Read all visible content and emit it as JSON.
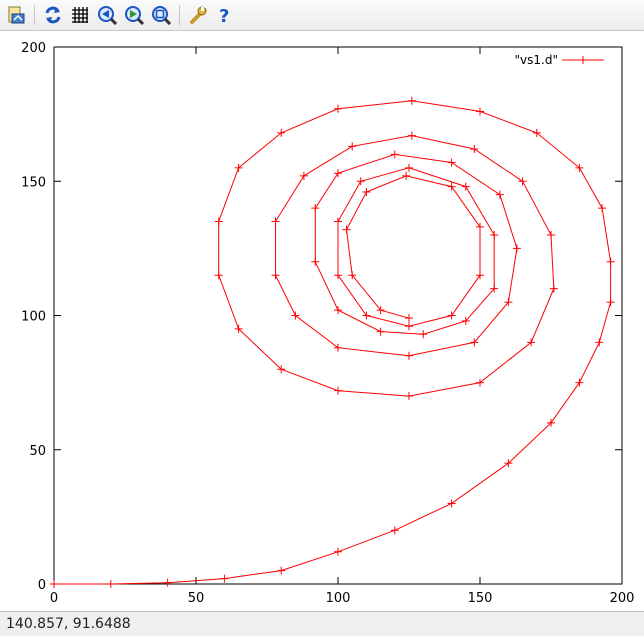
{
  "toolbar": {
    "buttons": [
      {
        "name": "export-icon"
      },
      {
        "name": "replot-icon"
      },
      {
        "name": "grid-icon"
      },
      {
        "name": "zoom-previous-icon"
      },
      {
        "name": "zoom-next-icon"
      },
      {
        "name": "autoscale-icon"
      },
      {
        "name": "options-wrench-icon"
      },
      {
        "name": "help-icon"
      }
    ]
  },
  "status": {
    "coordinates": "140.857, 91.6488"
  },
  "colors": {
    "series": "#ff0000",
    "axis": "#000000",
    "toolbar_blue": "#1a55c4"
  },
  "chart_data": {
    "type": "line",
    "title": "",
    "xlabel": "",
    "ylabel": "",
    "xlim": [
      0,
      200
    ],
    "ylim": [
      0,
      200
    ],
    "xticks": [
      "0",
      "50",
      "100",
      "150",
      "200"
    ],
    "yticks": [
      "0",
      "50",
      "100",
      "150",
      "200"
    ],
    "grid": false,
    "legend": {
      "position": "top-right"
    },
    "marker": "+",
    "series": [
      {
        "name": "\"vs1.d\"",
        "description_points": [
          [
            0,
            0
          ],
          [
            20,
            0
          ],
          [
            40,
            0.5
          ],
          [
            60,
            2
          ],
          [
            80,
            5
          ],
          [
            100,
            12
          ],
          [
            120,
            20
          ],
          [
            140,
            30
          ],
          [
            160,
            45
          ],
          [
            175,
            60
          ],
          [
            185,
            75
          ],
          [
            192,
            90
          ],
          [
            196,
            105
          ],
          [
            196,
            120
          ],
          [
            193,
            140
          ],
          [
            185,
            155
          ],
          [
            170,
            168
          ],
          [
            150,
            176
          ],
          [
            126,
            180
          ],
          [
            100,
            177
          ],
          [
            80,
            168
          ],
          [
            65,
            155
          ],
          [
            58,
            135
          ],
          [
            58,
            115
          ],
          [
            65,
            95
          ],
          [
            80,
            80
          ],
          [
            100,
            72
          ],
          [
            125,
            70
          ],
          [
            150,
            75
          ],
          [
            168,
            90
          ],
          [
            176,
            110
          ],
          [
            175,
            130
          ],
          [
            165,
            150
          ],
          [
            148,
            162
          ],
          [
            126,
            167
          ],
          [
            105,
            163
          ],
          [
            88,
            152
          ],
          [
            78,
            135
          ],
          [
            78,
            115
          ],
          [
            85,
            100
          ],
          [
            100,
            88
          ],
          [
            125,
            85
          ],
          [
            148,
            90
          ],
          [
            160,
            105
          ],
          [
            163,
            125
          ],
          [
            157,
            145
          ],
          [
            140,
            157
          ],
          [
            120,
            160
          ],
          [
            100,
            153
          ],
          [
            92,
            140
          ],
          [
            92,
            120
          ],
          [
            100,
            102
          ],
          [
            115,
            94
          ],
          [
            130,
            93
          ],
          [
            145,
            98
          ],
          [
            155,
            110
          ],
          [
            155,
            130
          ],
          [
            145,
            148
          ],
          [
            125,
            155
          ],
          [
            108,
            150
          ],
          [
            100,
            135
          ],
          [
            100,
            115
          ],
          [
            110,
            100
          ],
          [
            125,
            96
          ],
          [
            140,
            100
          ],
          [
            150,
            115
          ],
          [
            150,
            133
          ],
          [
            140,
            148
          ],
          [
            124,
            152
          ],
          [
            110,
            146
          ],
          [
            103,
            132
          ],
          [
            105,
            115
          ],
          [
            115,
            102
          ],
          [
            125,
            99
          ]
        ]
      }
    ]
  }
}
